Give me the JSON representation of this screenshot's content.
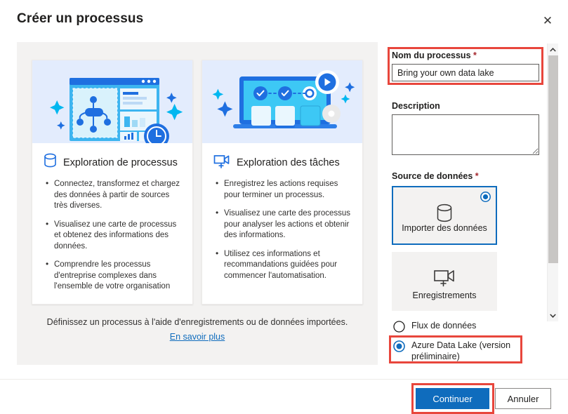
{
  "dialog": {
    "title": "Créer un processus",
    "close_icon": "close-icon"
  },
  "left_panel": {
    "cards": [
      {
        "icon": "database-cylinder-icon",
        "title": "Exploration de processus",
        "illustration": "process-mining-dashboard-illustration",
        "bullets": [
          "Connectez, transformez et chargez des données à partir de sources très diverses.",
          "Visualisez une carte de processus et obtenez des informations des données.",
          "Comprendre les processus d'entreprise complexes dans l'ensemble de votre organisation"
        ]
      },
      {
        "icon": "video-camera-plus-icon",
        "title": "Exploration des tâches",
        "illustration": "task-mining-laptop-illustration",
        "bullets": [
          "Enregistrez les actions requises pour terminer un processus.",
          "Visualisez une carte des processus pour analyser les actions et obtenir des informations.",
          "Utilisez ces informations et recommandations guidées pour commencer l'automatisation."
        ]
      }
    ],
    "footer_text": "Définissez un processus à l'aide d'enregistrements ou de données importées.",
    "learn_more_label": "En savoir plus"
  },
  "form": {
    "name_label": "Nom du processus",
    "name_required_mark": "*",
    "name_value": "Bring your own data lake",
    "name_placeholder": "",
    "description_label": "Description",
    "description_value": "",
    "description_placeholder": "",
    "source_label": "Source de données",
    "source_required_mark": "*",
    "source_tiles": [
      {
        "label": "Importer des données",
        "icon": "database-cylinder-icon",
        "selected": true
      },
      {
        "label": "Enregistrements",
        "icon": "video-camera-plus-icon",
        "selected": false
      }
    ],
    "source_options": [
      {
        "label": "Flux de données",
        "selected": false
      },
      {
        "label": "Azure Data Lake (version préliminaire)",
        "selected": true
      }
    ]
  },
  "scrollbar": {
    "up_arrow_icon": "chevron-up-icon",
    "down_arrow_icon": "chevron-down-icon"
  },
  "footer": {
    "continue_label": "Continuer",
    "cancel_label": "Annuler"
  },
  "colors": {
    "accent_blue": "#0f6cbd",
    "primary_button": "#0f6cbd",
    "highlight_red": "#e8463c",
    "required_red": "#a4262c",
    "panel_gray": "#f3f2f1",
    "illustration_bg": "#e3ecfd"
  }
}
